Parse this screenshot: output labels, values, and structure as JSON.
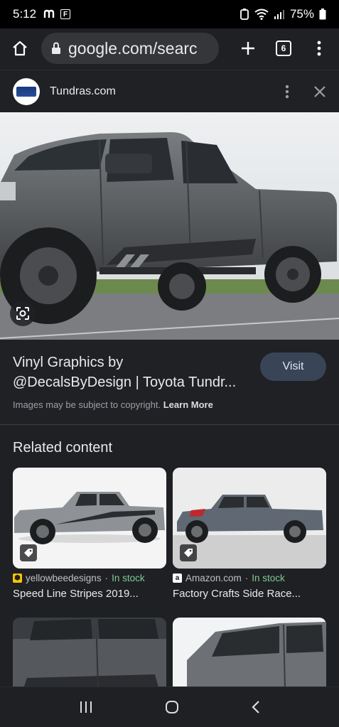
{
  "status": {
    "time": "5:12",
    "battery": "75%"
  },
  "browser": {
    "url": "google.com/searc",
    "tab_count": "6"
  },
  "viewer": {
    "site_name": "Tundras.com"
  },
  "result": {
    "title_line1": "Vinyl Graphics by",
    "title_line2": "@DecalsByDesign | Toyota Tundr...",
    "visit_label": "Visit",
    "copyright_text": "Images may be subject to copyright.",
    "learn_more": "Learn More"
  },
  "related": {
    "heading": "Related content",
    "items": [
      {
        "source": "yellowbeedesigns",
        "stock": "In stock",
        "title": "Speed Line Stripes 2019..."
      },
      {
        "source": "Amazon.com",
        "stock": "In stock",
        "title": "Factory Crafts Side Race..."
      }
    ]
  },
  "colors": {
    "background": "#202124",
    "accent_green": "#81c995",
    "visit_bg": "#394457"
  }
}
